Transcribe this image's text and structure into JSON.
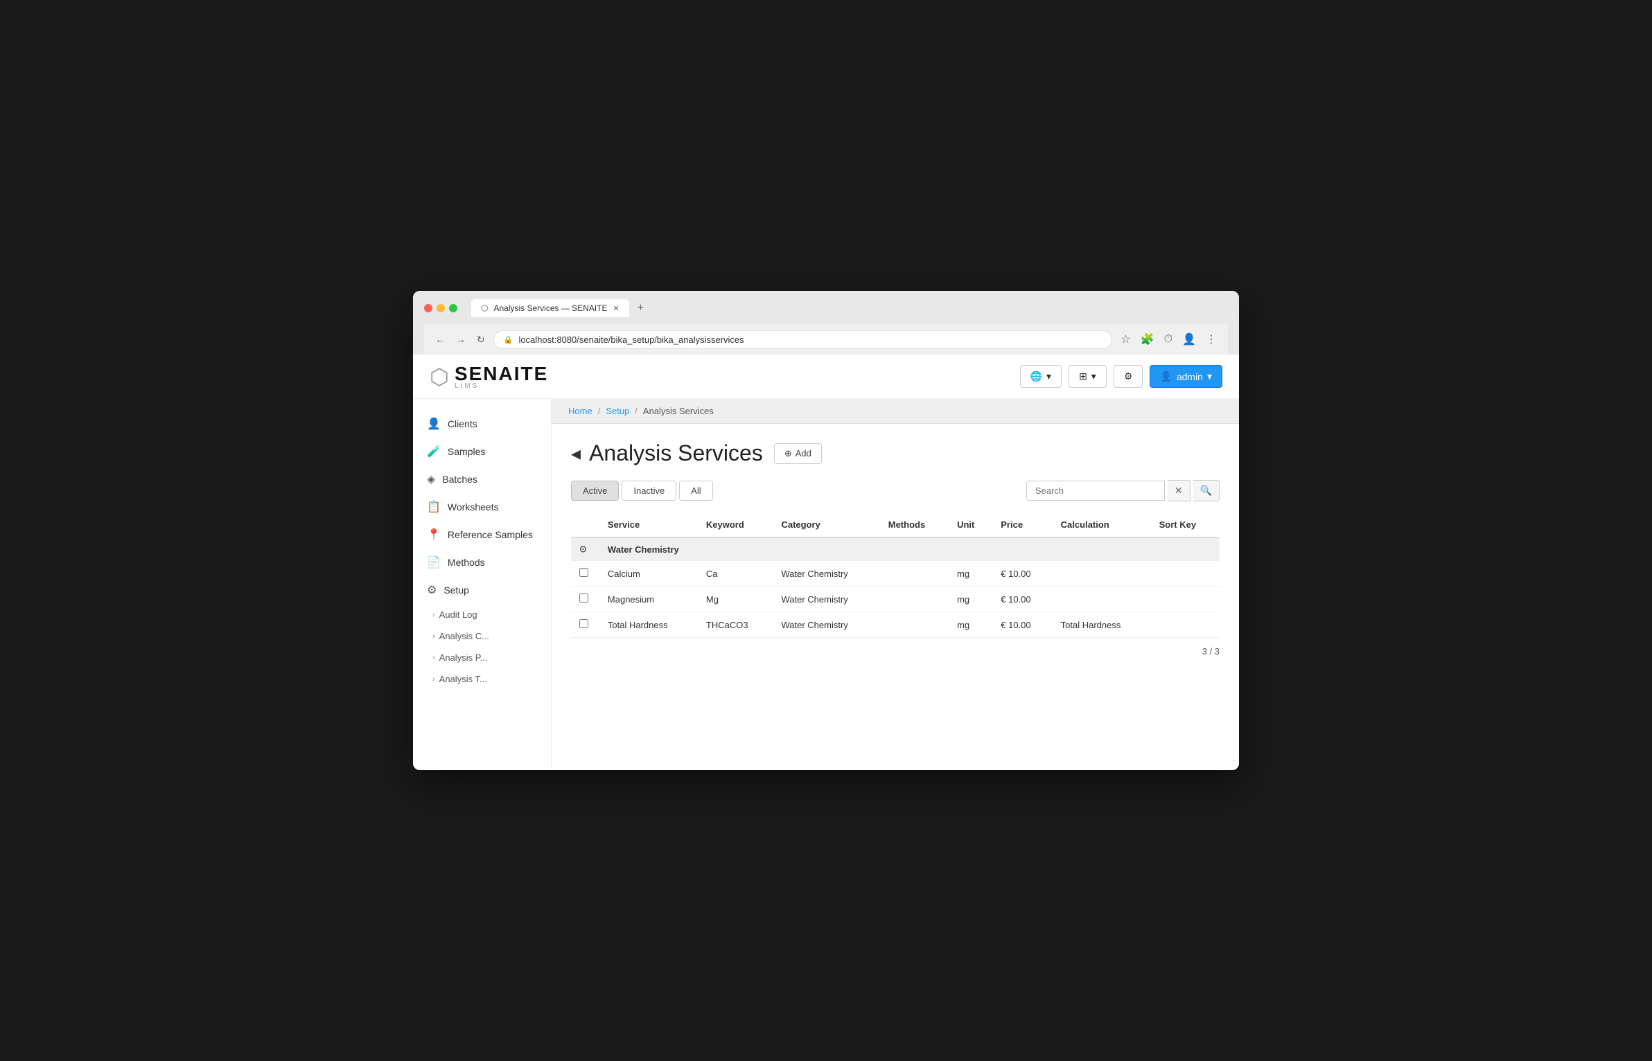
{
  "browser": {
    "tab_title": "Analysis Services — SENAITE",
    "url": "localhost:8080/senaite/bika_setup/bika_analysisservices",
    "nav_back": "←",
    "nav_forward": "→",
    "nav_refresh": "↻",
    "new_tab": "+"
  },
  "header": {
    "logo_text": "SENAITE",
    "logo_sub": "LIMS",
    "globe_btn": "🌐",
    "grid_btn": "⊞",
    "settings_btn": "⚙",
    "user_btn": "admin"
  },
  "sidebar": {
    "items": [
      {
        "id": "clients",
        "label": "Clients",
        "icon": "👤"
      },
      {
        "id": "samples",
        "label": "Samples",
        "icon": "🧪"
      },
      {
        "id": "batches",
        "label": "Batches",
        "icon": "◈"
      },
      {
        "id": "worksheets",
        "label": "Worksheets",
        "icon": "📋"
      },
      {
        "id": "reference-samples",
        "label": "Reference Samples",
        "icon": "📍"
      },
      {
        "id": "methods",
        "label": "Methods",
        "icon": "📄"
      },
      {
        "id": "setup",
        "label": "Setup",
        "icon": "⚙"
      }
    ],
    "sub_items": [
      {
        "id": "audit-log",
        "label": "Audit Log"
      },
      {
        "id": "analysis-c",
        "label": "Analysis C..."
      },
      {
        "id": "analysis-p",
        "label": "Analysis P..."
      },
      {
        "id": "analysis-t",
        "label": "Analysis T..."
      }
    ]
  },
  "breadcrumb": {
    "home": "Home",
    "setup": "Setup",
    "current": "Analysis Services"
  },
  "page": {
    "title": "Analysis Services",
    "title_icon": "◂",
    "add_btn": "Add"
  },
  "filters": {
    "active": "Active",
    "inactive": "Inactive",
    "all": "All"
  },
  "search": {
    "placeholder": "Search",
    "clear_icon": "✕",
    "search_icon": "🔍"
  },
  "table": {
    "columns": [
      "Service",
      "Keyword",
      "Category",
      "Methods",
      "Unit",
      "Price",
      "Calculation",
      "Sort Key"
    ],
    "category_group": "Water Chemistry",
    "rows": [
      {
        "service": "Calcium",
        "keyword": "Ca",
        "category": "Water Chemistry",
        "methods": "",
        "unit": "mg",
        "price": "€ 10.00",
        "calculation": "",
        "sort_key": ""
      },
      {
        "service": "Magnesium",
        "keyword": "Mg",
        "category": "Water Chemistry",
        "methods": "",
        "unit": "mg",
        "price": "€ 10.00",
        "calculation": "",
        "sort_key": ""
      },
      {
        "service": "Total Hardness",
        "keyword": "THCaCO3",
        "category": "Water Chemistry",
        "methods": "",
        "unit": "mg",
        "price": "€ 10.00",
        "calculation": "Total Hardness",
        "sort_key": ""
      }
    ]
  },
  "pagination": {
    "text": "3 / 3"
  }
}
